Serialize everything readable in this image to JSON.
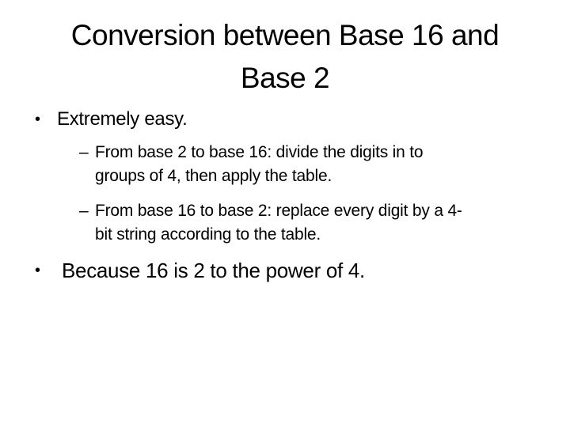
{
  "slide": {
    "title_lines": [
      "Conversion between Base 16 and",
      "Base 2"
    ],
    "bullets": [
      {
        "marker": "•",
        "text": "Extremely easy.",
        "sub_bullets": [
          {
            "marker": "–",
            "lines": [
              "From base 2 to base 16: divide the digits in to",
              "groups of 4, then apply the table."
            ]
          },
          {
            "marker": "–",
            "lines": [
              "From base 16 to base 2: replace every digit by a 4-",
              "bit string according to the table."
            ]
          }
        ]
      },
      {
        "marker": "•",
        "text": "Because 16 is 2 to the power of 4."
      }
    ]
  }
}
